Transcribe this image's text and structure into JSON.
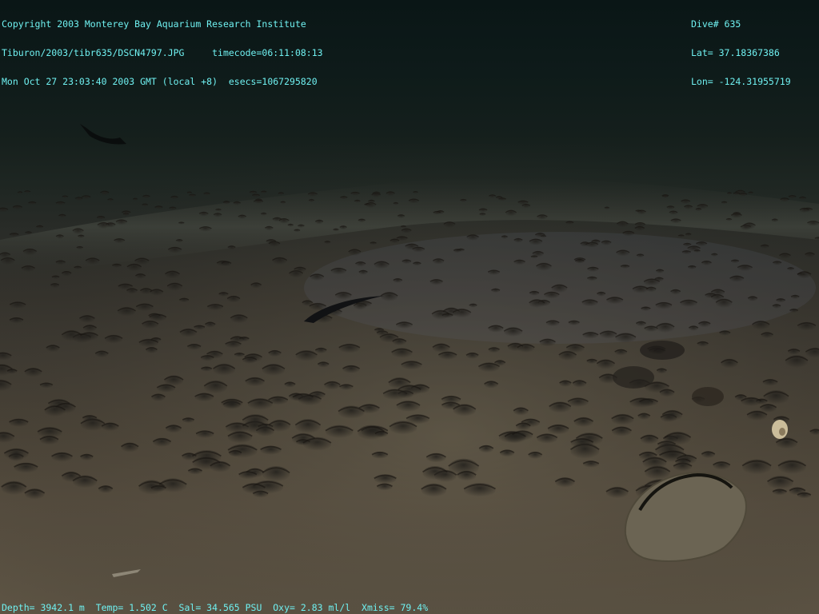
{
  "overlay": {
    "header_left": [
      "Copyright 2003 Monterey Bay Aquarium Research Institute",
      "Tiburon/2003/tibr635/DSCN4797.JPG     timecode=06:11:08:13",
      "Mon Oct 27 23:03:40 2003 GMT (local +8)  esecs=1067295820"
    ],
    "header_right": [
      "Dive# 635",
      "Lat= 37.18367386",
      "Lon= -124.31955719"
    ],
    "footer": "Depth= 3942.1 m  Temp= 1.502 C  Sal= 34.565 PSU  Oxy= 2.83 ml/l  Xmiss= 79.4%"
  },
  "colors": {
    "overlay_text": "#6ff0f0",
    "water": "#0b1716",
    "sediment": "#5a5142"
  },
  "scene": {
    "subject": "deep-sea sediment seafloor with clam-bed depressions, rocks and small organisms"
  }
}
